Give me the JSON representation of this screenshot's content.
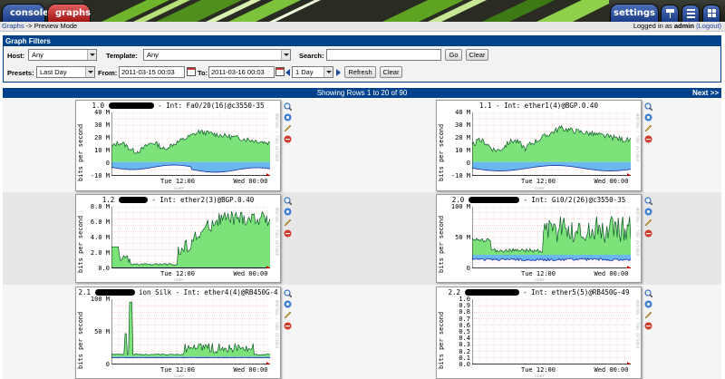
{
  "topnav": {
    "console": "console",
    "graphs": "graphs",
    "settings": "settings"
  },
  "breadcrumb": {
    "link": "Graphs",
    "sep": "->",
    "current": "Preview Mode",
    "logged_in_prefix": "Logged in as",
    "user": "admin",
    "logout": "(Logout)"
  },
  "filters": {
    "header": "Graph Filters",
    "host_label": "Host:",
    "host_value": "Any",
    "template_label": "Template:",
    "template_value": "Any",
    "search_label": "Search:",
    "search_value": "",
    "go": "Go",
    "clear": "Clear",
    "presets_label": "Presets:",
    "presets_value": "Last Day",
    "from_label": "From:",
    "from_value": "2011-03-15 00:03",
    "to_label": "To:",
    "to_value": "2011-03-16 00:03",
    "timespan_value": "1 Day",
    "refresh": "Refresh",
    "clear2": "Clear"
  },
  "results": {
    "showing": "Showing Rows 1 to 20 of 90",
    "next": "Next >>"
  },
  "graph_common": {
    "ylabel": "bits per second",
    "side_text": "RRDTOOL / TOBI OETIKER",
    "cdef": "CDEF"
  },
  "graphs": [
    {
      "title_pre": "1.0",
      "title_post": "- Int: Fa0/20(16)@c3550-35",
      "yticks": [
        "40 M",
        "30 M",
        "20 M",
        "10 M",
        "0",
        "-10 M"
      ],
      "xticks": [
        "Tue 12:00",
        "Wed 00:00"
      ]
    },
    {
      "title_pre": "1.1",
      "title_post": "- Int: ether1(4)@BGP.0.40",
      "yticks": [
        "40 M",
        "30 M",
        "20 M",
        "10 M",
        "0",
        "-10 M"
      ],
      "xticks": [
        "Tue 12:00",
        "Wed 00:00"
      ]
    },
    {
      "title_pre": "1.2",
      "title_post": "- Int: ether2(3)@BGP.0.40",
      "yticks": [
        "8.0 M",
        "6.0 M",
        "4.0 M",
        "2.0 M",
        "0.0"
      ],
      "xticks": [
        "Tue 12:00",
        "Wed 00:00"
      ]
    },
    {
      "title_pre": "2.0",
      "title_post": "- Int: Gi0/2(26)@c3550-35",
      "yticks": [
        "100 M",
        "50 M",
        "0"
      ],
      "xticks": [
        "Tue 12:00",
        "Wed 00:00"
      ]
    },
    {
      "title_pre": "2.1",
      "title_post": "ion Silk - Int: ether4(4)@RB450G-4",
      "yticks": [
        "100 M",
        "50 M",
        "0"
      ],
      "xticks": [
        "Tue 12:00",
        "Wed 00:00"
      ]
    },
    {
      "title_pre": "2.2",
      "title_post": "- Int: ether5(5)@RB450G-49",
      "yticks": [
        "1.0",
        "0.9",
        "0.8",
        "0.7",
        "0.6",
        "0.5",
        "0.4",
        "0.3",
        "0.2",
        "0.1",
        "0.0"
      ],
      "xticks": [
        "Tue 12:00",
        "Wed 00:00"
      ]
    }
  ],
  "colors": {
    "nav_blue": "#00438c",
    "inbound_fill": "#7ee27a",
    "outbound_fill": "#6ab8ee",
    "inbound_line": "#0b5a2a",
    "outbound_line": "#1a2ea8",
    "grid": "#f0a0a0"
  }
}
